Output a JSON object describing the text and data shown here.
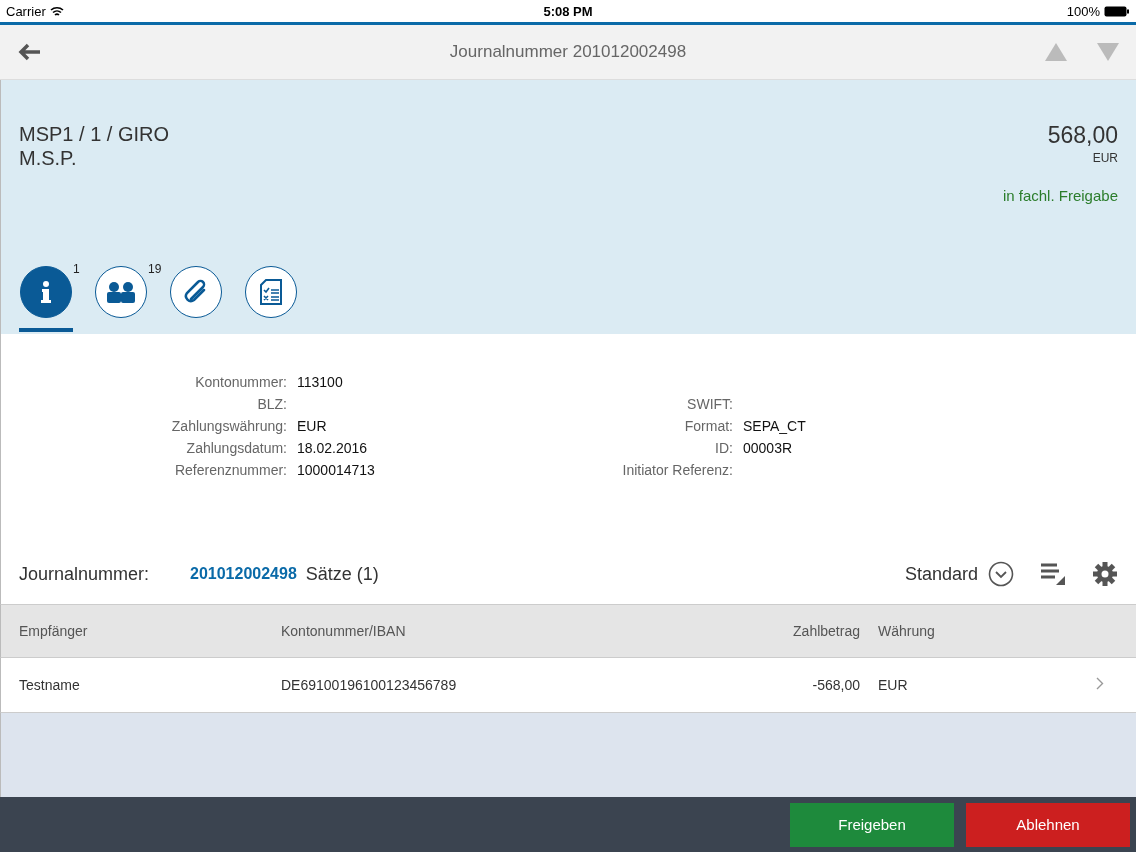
{
  "status_bar": {
    "carrier": "Carrier",
    "time": "5:08 PM",
    "battery": "100%"
  },
  "nav": {
    "title": "Journalnummer 201012002498"
  },
  "header": {
    "title": "MSP1 / 1 / GIRO",
    "subtitle": "M.S.P.",
    "amount": "568,00",
    "currency": "EUR",
    "status": "in fachl. Freigabe"
  },
  "tabs": [
    {
      "kind": "info",
      "count": "1",
      "selected": true
    },
    {
      "kind": "people",
      "count": "19",
      "selected": false
    },
    {
      "kind": "attachment",
      "selected": false
    },
    {
      "kind": "checklist",
      "selected": false
    }
  ],
  "form_rows": [
    {
      "left": {
        "label": "Kontonummer:",
        "value": "113100"
      }
    },
    {
      "left": {
        "label": "BLZ:"
      },
      "right": {
        "label": "SWIFT:"
      }
    },
    {
      "left": {
        "label": "Zahlungswährung:",
        "value": "EUR"
      },
      "right": {
        "label": "Format:",
        "value": "SEPA_CT"
      }
    },
    {
      "left": {
        "label": "Zahlungsdatum:",
        "value": "18.02.2016"
      },
      "right": {
        "label": "ID:",
        "value": "00003R"
      }
    },
    {
      "left": {
        "label": "Referenznummer:",
        "value": "1000014713"
      },
      "right": {
        "label": "Initiator Referenz:"
      }
    }
  ],
  "table_toolbar": {
    "label": "Journalnummer:",
    "link": "201012002498",
    "count": "Sätze (1)",
    "variant": "Standard"
  },
  "table": {
    "columns": [
      "Empfänger",
      "Kontonummer/IBAN",
      "Zahlbetrag",
      "Währung"
    ],
    "rows": [
      [
        "Testname",
        "DE69100196100123456789",
        "-568,00",
        "EUR"
      ]
    ]
  },
  "footer": {
    "buttons": [
      {
        "label": "Freigeben",
        "kind": "accept"
      },
      {
        "label": "Ablehnen",
        "kind": "reject"
      }
    ]
  }
}
